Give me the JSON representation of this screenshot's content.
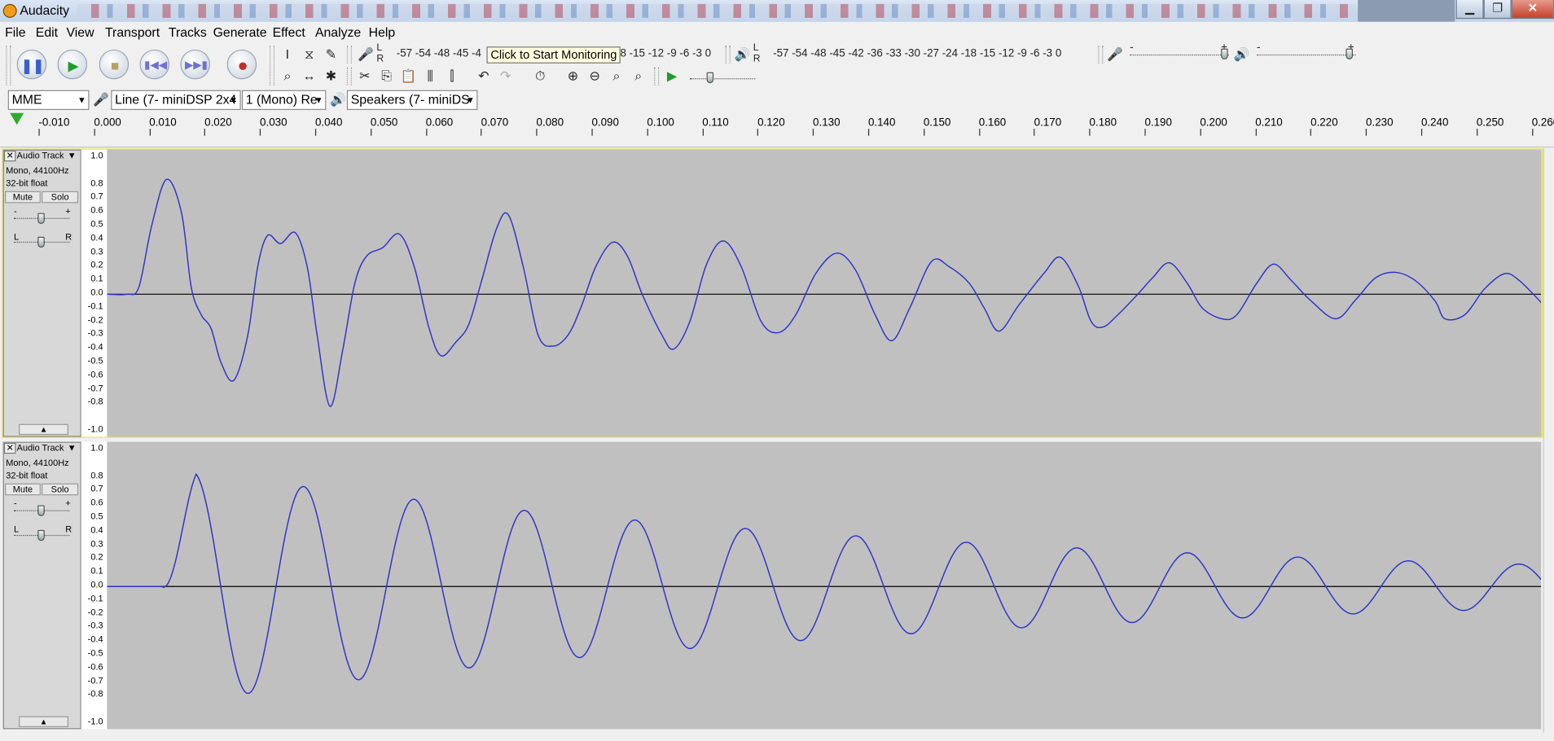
{
  "window": {
    "title": "Audacity",
    "min": "▁",
    "max": "❐",
    "close": "✕"
  },
  "menu": [
    "File",
    "Edit",
    "View",
    "Transport",
    "Tracks",
    "Generate",
    "Effect",
    "Analyze",
    "Help"
  ],
  "transport": {
    "pause": "Pause",
    "play": "Play",
    "stop": "Stop",
    "skip_start": "Skip to Start",
    "skip_end": "Skip to End",
    "record": "Record"
  },
  "meters": {
    "rec_L": "L",
    "rec_R": "R",
    "rec_scale": "-57 -54   -48 -45 -4",
    "rec_scale_tail": "-18 -15 -12  -9  -6  -3  0",
    "play_L": "L",
    "play_R": "R",
    "play_scale": "-57 -54    -48 -45 -42     -36 -33 -30 -27 -24     -18 -15 -12  -9  -6  -3  0",
    "tooltip": "Click to Start Monitoring"
  },
  "mixer": {
    "rec_minus": "-",
    "rec_plus": "+",
    "play_minus": "-",
    "play_plus": "+"
  },
  "device": {
    "host": "MME",
    "input": "Line (7- miniDSP 2x4",
    "channels": "1 (Mono) Re",
    "output": "Speakers (7- miniDS"
  },
  "ruler": {
    "labels": [
      "-0.010",
      "0.000",
      "0.010",
      "0.020",
      "0.030",
      "0.040",
      "0.050",
      "0.060",
      "0.070",
      "0.080",
      "0.090",
      "0.100",
      "0.110",
      "0.120",
      "0.130",
      "0.140",
      "0.150",
      "0.160",
      "0.170",
      "0.180",
      "0.190",
      "0.200",
      "0.210",
      "0.220",
      "0.230",
      "0.240",
      "0.250",
      "0.260"
    ]
  },
  "tracks": [
    {
      "name": "Audio Track",
      "info1": "Mono, 44100Hz",
      "info2": "32-bit float",
      "mute": "Mute",
      "solo": "Solo",
      "gain_minus": "-",
      "gain_plus": "+",
      "pan_left": "L",
      "pan_right": "R",
      "close": "✕",
      "menu_arrow": "▼",
      "collapse": "▲"
    },
    {
      "name": "Audio Track",
      "info1": "Mono, 44100Hz",
      "info2": "32-bit float",
      "mute": "Mute",
      "solo": "Solo",
      "gain_minus": "-",
      "gain_plus": "+",
      "pan_left": "L",
      "pan_right": "R",
      "close": "✕",
      "menu_arrow": "▼",
      "collapse": "▲"
    }
  ],
  "vscale": [
    "1.0",
    "0.8",
    "0.7",
    "0.6",
    "0.5",
    "0.4",
    "0.3",
    "0.2",
    "0.1",
    "0.0",
    "-0.1",
    "-0.2",
    "-0.3",
    "-0.4",
    "-0.5",
    "-0.6",
    "-0.7",
    "-0.8",
    "-1.0"
  ],
  "colors": {
    "wave": "#3232c8",
    "wave_bg": "#c0c0c0",
    "selected_border": "#e8e84a"
  }
}
